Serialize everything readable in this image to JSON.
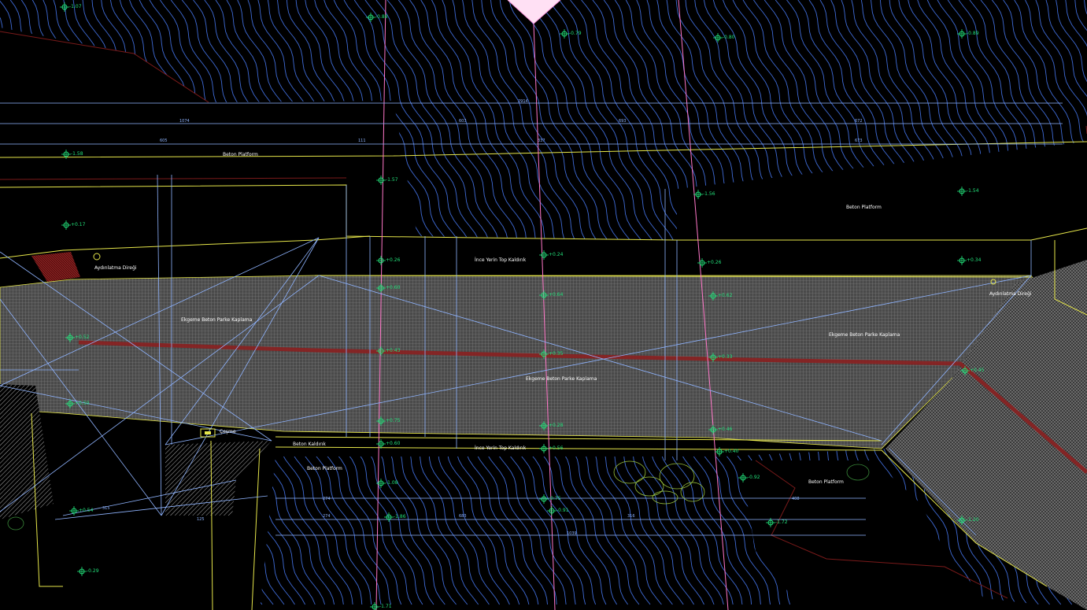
{
  "labels": {
    "beton_platform_1": "Beton Platform",
    "beton_platform_2": "Beton Platform",
    "beton_platform_3": "Beton Platform",
    "beton_platform_4": "Beton Platform",
    "yerinde_kaldirim_top": "İnce Yerin Top Kaldırık",
    "yerinde_kaldirim_bottom": "İnce Yerin Top Kaldırık",
    "agirlik_beton_1": "Ekgeme Beton Parke Kaplama",
    "agirlik_beton_2": "Ekgeme Beton Parke Kaplama",
    "agirlik_beton_3": "Ekgeme Beton Parke Kaplama",
    "aydinlatma_1": "Aydınlatma Direği",
    "aydinlatma_2": "Aydınlatma Direği",
    "beton_kaldirim": "Beton Kaldırık",
    "cesme": "Çeşme"
  },
  "elevations": {
    "e1": "-1.07",
    "e2": "-0.88",
    "e3": "-0.79",
    "e4": "-0.80",
    "e5": "-0.89",
    "e6": "-1.58",
    "e7": "-1.57",
    "e8": "-1.56",
    "e9": "-1.54",
    "e10": "+0.17",
    "e11": "+0.26",
    "e12": "+0.24",
    "e13": "+0.26",
    "e14": "+0.34",
    "e15": "+0.60",
    "e16": "+0.64",
    "e17": "+0.62",
    "e18": "+0.52",
    "e19": "+0.43",
    "e20": "+0.35",
    "e21": "+0.33",
    "e22": "+0.45",
    "e23": "+0.50",
    "e24": "+0.75",
    "e25": "+0.28",
    "e26": "+0.46",
    "e27": "+0.60",
    "e28": "+0.56",
    "e29": "+0.40",
    "e30": "+0.54",
    "e31": "-1.08",
    "e32": "-0.92",
    "e33": "-0.75",
    "e34": "-1.72",
    "e35": "-1.20",
    "e36": "-1.86",
    "e37": "-0.91",
    "e38": "-0.53",
    "e39": "+0.56",
    "e40": "-0.29",
    "e41": "-1.71"
  },
  "dims": {
    "d1": "2914",
    "d2": "1074",
    "d3": "603",
    "d4": "693",
    "d5": "672",
    "d6": "605",
    "d7": "111",
    "d8": "337",
    "d9": "673",
    "d10": "274",
    "d11": "274",
    "d12": "683",
    "d13": "1039",
    "d14": "408",
    "d15": "316",
    "d16": "315",
    "d17": "125"
  }
}
